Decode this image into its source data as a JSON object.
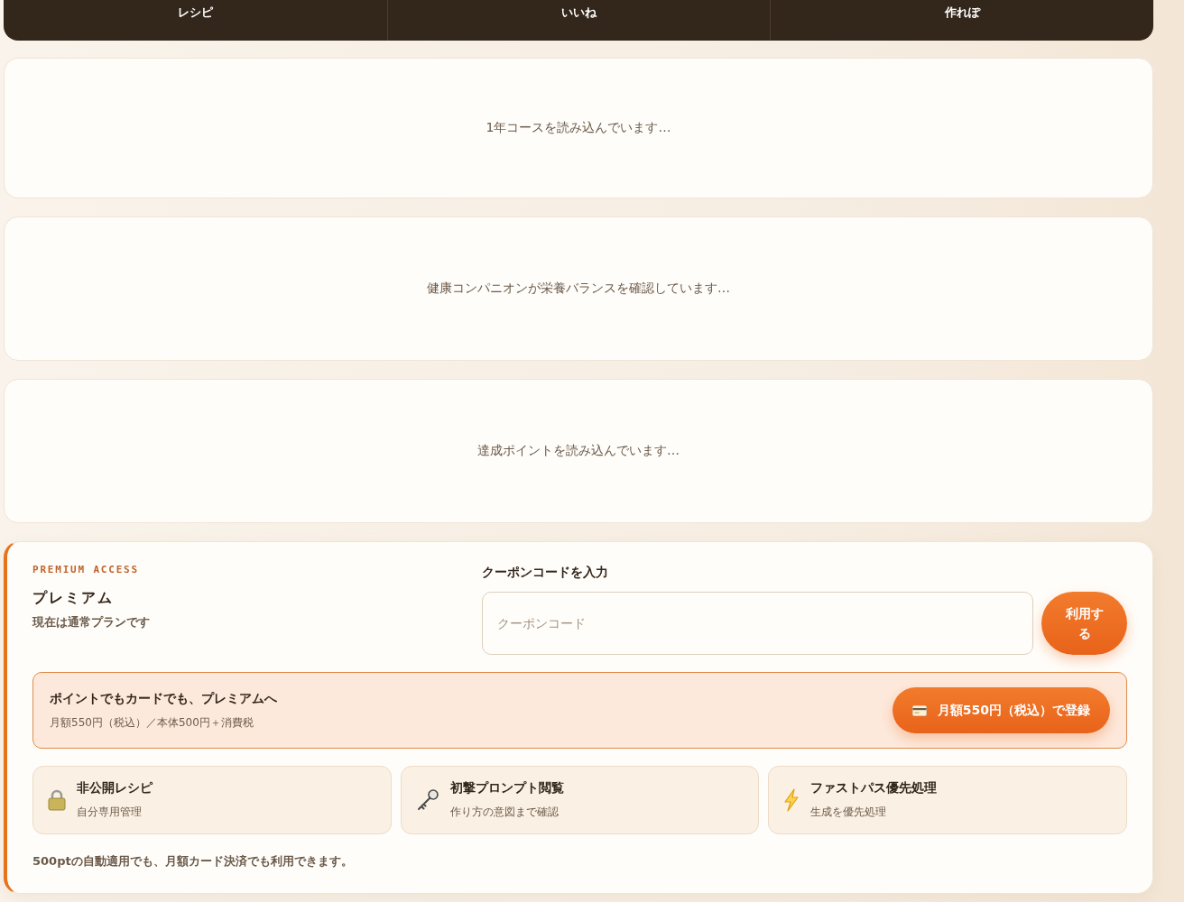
{
  "nav": {
    "tabs": [
      {
        "label": "レシピ"
      },
      {
        "label": "いいね"
      },
      {
        "label": "作れぽ"
      }
    ]
  },
  "loading_cards": [
    {
      "message": "1年コースを読み込んでいます…"
    },
    {
      "message": "健康コンパニオンが栄養バランスを確認しています…"
    },
    {
      "message": "達成ポイントを読み込んでいます…"
    }
  ],
  "premium": {
    "eyebrow": "PREMIUM ACCESS",
    "title": "プレミアム",
    "status": "現在は通常プランです",
    "coupon": {
      "label": "クーポンコードを入力",
      "placeholder": "クーポンコード",
      "button": "利用する"
    },
    "offer": {
      "title": "ポイントでもカードでも、プレミアムへ",
      "price_note": "月額550円（税込）／本体500円＋消費税",
      "button": "月額550円（税込）で登録"
    },
    "features": [
      {
        "kind": "lock",
        "title": "非公開レシピ",
        "description": "自分専用管理"
      },
      {
        "kind": "key",
        "title": "初撃プロンプト閲覧",
        "description": "作り方の意図まで確認"
      },
      {
        "kind": "bolt",
        "title": "ファストパス優先処理",
        "description": "生成を優先処理"
      }
    ],
    "note": "500ptの自動適用でも、月額カード決済でも利用できます。"
  }
}
